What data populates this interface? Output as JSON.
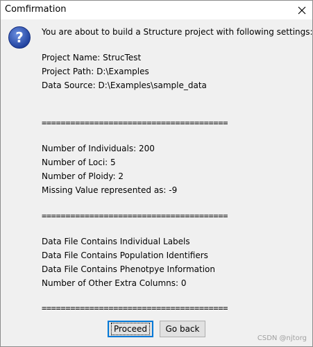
{
  "window": {
    "title": "Comfirmation"
  },
  "dialog": {
    "message": "You are about to build a Structure project with following settings:",
    "project": {
      "name_line": "Project Name:  StrucTest",
      "path_line": "Project Path:  D:\\Examples",
      "source_line": "Data Source:  D:\\Examples\\sample_data"
    },
    "separator": "=======================================",
    "params": {
      "individuals_line": "Number of Individuals:  200",
      "loci_line": "Number of Loci:  5",
      "ploidy_line": "Number of Ploidy:  2",
      "missing_line": "Missing Value represented as:  -9"
    },
    "file_info": {
      "labels_line": "Data File Contains Individual Labels",
      "pop_line": "Data File Contains Population Identifiers",
      "pheno_line": "Data File Contains Phenotpye Information",
      "extra_line": "Number of Other Extra Columns:  0"
    }
  },
  "buttons": {
    "proceed": "Proceed",
    "go_back": "Go back"
  },
  "watermark": "CSDN @njtorg",
  "icons": {
    "title_close": "close-icon",
    "dialog": "question-icon"
  },
  "colors": {
    "question_icon": "#2850b4",
    "focus_border": "#0078d7"
  }
}
